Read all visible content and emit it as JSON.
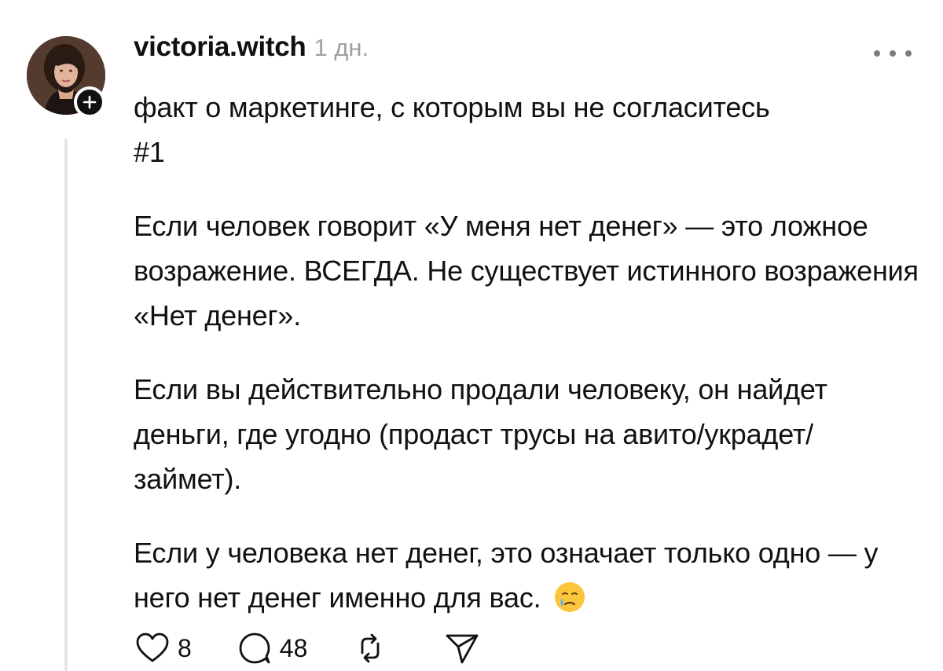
{
  "post": {
    "author": {
      "username": "victoria.witch",
      "avatar": "profile-photo",
      "follow_icon": "plus-icon"
    },
    "time": "1 дн.",
    "more_icon": "more-horizontal-icon",
    "content": {
      "line1": "факт о маркетинге, с которым вы не согласитесь",
      "line2": "#1",
      "paragraph2": "Если человек говорит «У меня нет денег» — это ложное возражение. ВСЕГДА. Не существует истинного возражения «Нет денег».",
      "paragraph3": "Если вы действительно продали человеку, он найдет деньги, где угодно (продаст трусы на авито/украдет/займет).",
      "paragraph4": "Если у человека нет денег, это означает только одно — у него нет денег именно для вас.",
      "emoji": "crying-face-emoji"
    },
    "actions": {
      "likes": "8",
      "comments": "48",
      "like_icon": "heart-icon",
      "comment_icon": "comment-icon",
      "repost_icon": "repost-icon",
      "share_icon": "send-icon"
    }
  },
  "colors": {
    "text": "#111111",
    "muted": "#a0a0a0",
    "thread_line": "#e6e6e6",
    "background": "#ffffff"
  }
}
